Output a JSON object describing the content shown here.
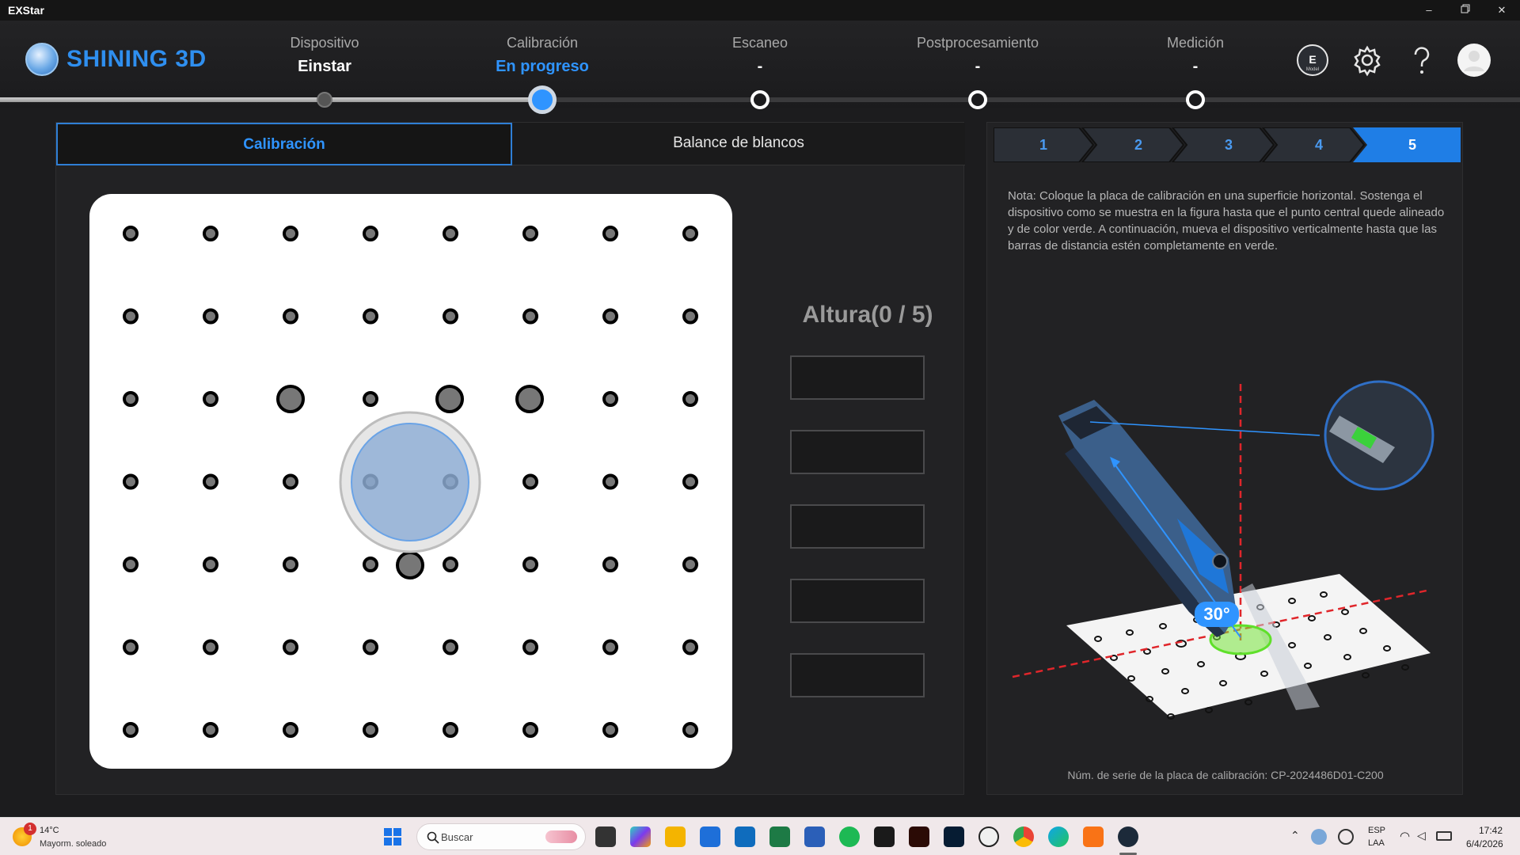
{
  "window": {
    "title": "EXStar",
    "min_icon": "minimize-icon",
    "restore_icon": "restore-icon",
    "close_icon": "close-icon"
  },
  "header": {
    "logo_text": "SHINING 3D",
    "steps": [
      {
        "label": "Dispositivo",
        "status": "Einstar",
        "state": "done"
      },
      {
        "label": "Calibración",
        "status": "En progreso",
        "state": "active"
      },
      {
        "label": "Escaneo",
        "status": "-",
        "state": "pending"
      },
      {
        "label": "Postprocesamiento",
        "status": "-",
        "state": "pending"
      },
      {
        "label": "Medición",
        "status": "-",
        "state": "pending"
      }
    ],
    "icons": [
      "model-icon",
      "gear-icon",
      "help-icon",
      "avatar-icon"
    ],
    "model_badge": "E",
    "model_caption": "Model"
  },
  "left": {
    "tabs": [
      {
        "label": "Calibración",
        "active": true
      },
      {
        "label": "Balance de blancos",
        "active": false
      }
    ],
    "height_title": "Altura(0 / 5)",
    "height_progress": 0,
    "height_total": 5
  },
  "right": {
    "wizard_steps": [
      "1",
      "2",
      "3",
      "4",
      "5"
    ],
    "wizard_active": 5,
    "note": "Nota: Coloque la placa de calibración en una superficie horizontal. Sostenga el dispositivo como se muestra en la figura hasta que el punto central quede alineado y de color verde. A continuación, mueva el dispositivo verticalmente hasta que las barras de distancia estén completamente en verde.",
    "angle_label": "30°",
    "serial": "Núm. de serie de la placa de calibración: CP-2024486D01-C200"
  },
  "colors": {
    "accent": "#2f94ff",
    "green": "#3bd13b",
    "panel": "#222224",
    "guide_red": "#e0262b"
  },
  "taskbar": {
    "weather_temp": "14°C",
    "weather_desc": "Mayorm. soleado",
    "weather_badge": "1",
    "search_placeholder": "Buscar",
    "lang_1": "ESP",
    "lang_2": "LAA",
    "time": "17:42",
    "date": "6/4/2026"
  }
}
